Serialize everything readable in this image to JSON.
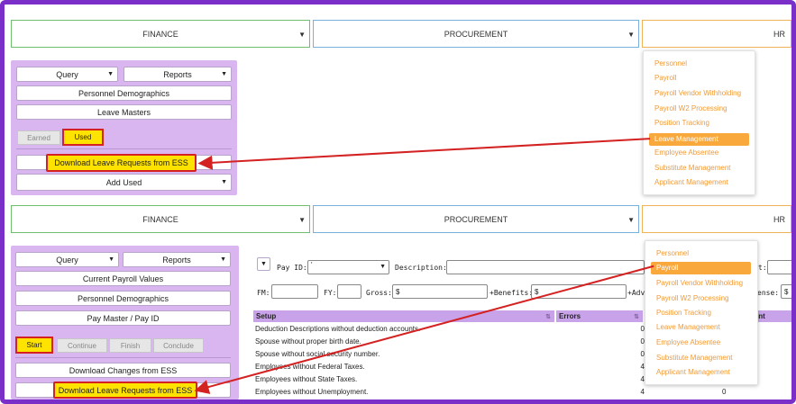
{
  "top": {
    "modules": [
      {
        "label": "FINANCE"
      },
      {
        "label": "PROCUREMENT"
      },
      {
        "label": "HR"
      }
    ],
    "panel": {
      "query": "Query",
      "reports": "Reports",
      "rows": [
        "Personnel Demographics",
        "Leave Masters"
      ],
      "tabs": [
        "Earned",
        "Used"
      ],
      "download": "Download Leave Requests from ESS",
      "add_used": "Add Used"
    },
    "hr_menu": [
      "Personnel",
      "Payroll",
      "Payroll Vendor Withholding",
      "Payroll W2 Processing",
      "Position Tracking",
      "Leave Management",
      "Employee Absentee",
      "Substitute Management",
      "Applicant Management"
    ],
    "hr_menu_active": "Leave Management"
  },
  "bottom": {
    "modules": [
      {
        "label": "FINANCE"
      },
      {
        "label": "PROCUREMENT"
      },
      {
        "label": "HR"
      }
    ],
    "panel": {
      "query": "Query",
      "reports": "Reports",
      "rows": [
        "Current Payroll Values",
        "Personnel Demographics",
        "Pay Master / Pay ID"
      ],
      "tabs": [
        "Start",
        "Continue",
        "Finish",
        "Conclude"
      ],
      "download_changes": "Download Changes from ESS",
      "download_leave": "Download Leave Requests from ESS"
    },
    "hr_menu": [
      "Personnel",
      "Payroll",
      "Payroll Vendor Withholding",
      "Payroll W2 Processing",
      "Position Tracking",
      "Leave Management",
      "Employee Absentee",
      "Substitute Management",
      "Applicant Management"
    ],
    "hr_menu_active": "Payroll",
    "form": {
      "pay_id_label": "Pay ID:",
      "pay_id_value": "'",
      "description_label": "Description:",
      "fm_label": "FM:",
      "fy_label": "FY:",
      "gross_label": "Gross:",
      "gross_value": "$",
      "benefits_label": "+Benefits:",
      "benefits_value": "$",
      "adv_label": "+Adv",
      "t_label": "t:",
      "ense_label": "ense:",
      "ense_value": "$"
    },
    "grid": {
      "columns": [
        "Setup",
        "Errors",
        "int"
      ],
      "rows": [
        {
          "setup": "Deduction Descriptions without deduction accounts.",
          "errors": "0",
          "extra": ""
        },
        {
          "setup": "Spouse without proper birth date.",
          "errors": "0",
          "extra": ""
        },
        {
          "setup": "Spouse without social security number.",
          "errors": "0",
          "extra": ""
        },
        {
          "setup": "Employees without Federal Taxes.",
          "errors": "4",
          "extra": ""
        },
        {
          "setup": "Employees without State Taxes.",
          "errors": "4",
          "extra": ""
        },
        {
          "setup": "Employees without Unemployment.",
          "errors": "4",
          "extra": "0"
        }
      ]
    }
  },
  "colors": {
    "frame": "#7b2fc9",
    "panel": "#d9b6f0",
    "highlight": "#ffe300",
    "annotation_red": "#d42121",
    "menu_text": "#f29a34",
    "menu_active": "#f9a83c"
  }
}
